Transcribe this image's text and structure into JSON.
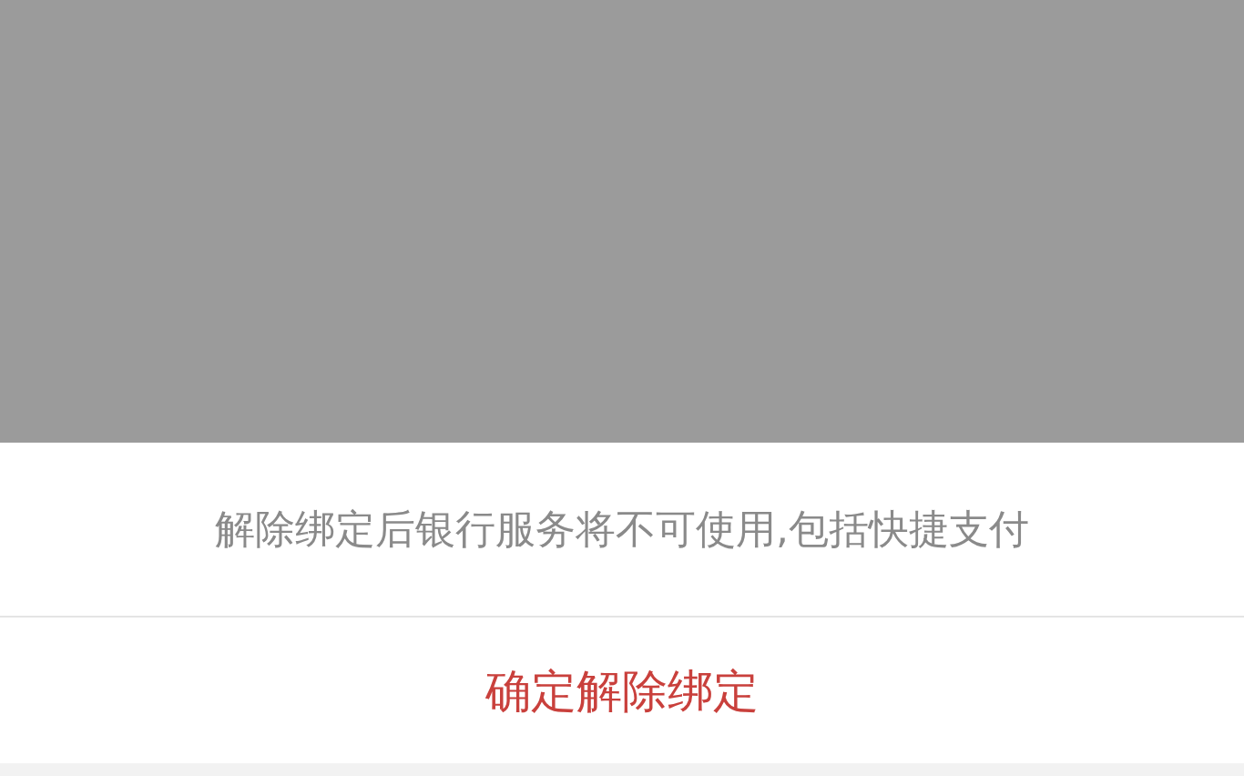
{
  "action_sheet": {
    "message": "解除绑定后银行服务将不可使用,包括快捷支付",
    "actions": [
      {
        "label": "确定解除绑定",
        "kind": "destructive"
      }
    ]
  }
}
